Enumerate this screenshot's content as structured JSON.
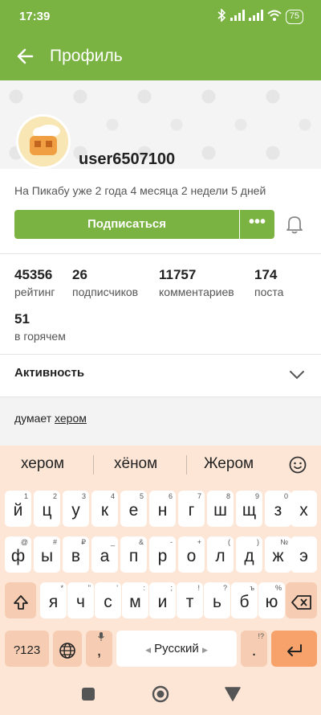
{
  "status": {
    "time": "17:39",
    "battery": "75"
  },
  "appbar": {
    "title": "Профиль"
  },
  "profile": {
    "username": "user6507100",
    "since": "На Пикабу уже 2 года 4 месяца 2 недели 5 дней",
    "subscribe_label": "Подписаться",
    "more_label": "•••"
  },
  "stats": [
    {
      "num": "45356",
      "label": "рейтинг"
    },
    {
      "num": "26",
      "label": "подписчиков"
    },
    {
      "num": "11757",
      "label": "комментариев"
    },
    {
      "num": "174",
      "label": "поста"
    },
    {
      "num": "51",
      "label": "в горячем"
    }
  ],
  "activity": {
    "label": "Активность"
  },
  "thinks": {
    "prefix": "думает",
    "link": "хером"
  },
  "keyboard": {
    "suggestions": [
      "хером",
      "хёном",
      "Жером"
    ],
    "row1": [
      {
        "k": "й",
        "s": "1"
      },
      {
        "k": "ц",
        "s": "2"
      },
      {
        "k": "у",
        "s": "3"
      },
      {
        "k": "к",
        "s": "4"
      },
      {
        "k": "е",
        "s": "5"
      },
      {
        "k": "н",
        "s": "6"
      },
      {
        "k": "г",
        "s": "7"
      },
      {
        "k": "ш",
        "s": "8"
      },
      {
        "k": "щ",
        "s": "9"
      },
      {
        "k": "з",
        "s": "0"
      },
      {
        "k": "х",
        "s": ""
      }
    ],
    "row2": [
      {
        "k": "ф",
        "s": "@"
      },
      {
        "k": "ы",
        "s": "#"
      },
      {
        "k": "в",
        "s": "₽"
      },
      {
        "k": "а",
        "s": "_"
      },
      {
        "k": "п",
        "s": "&"
      },
      {
        "k": "р",
        "s": "-"
      },
      {
        "k": "о",
        "s": "+"
      },
      {
        "k": "л",
        "s": "("
      },
      {
        "k": "д",
        "s": ")"
      },
      {
        "k": "ж",
        "s": "№"
      },
      {
        "k": "э",
        "s": ""
      }
    ],
    "row3": [
      {
        "k": "я",
        "s": "*"
      },
      {
        "k": "ч",
        "s": "\""
      },
      {
        "k": "с",
        "s": "'"
      },
      {
        "k": "м",
        "s": ":"
      },
      {
        "k": "и",
        "s": ";"
      },
      {
        "k": "т",
        "s": "!"
      },
      {
        "k": "ь",
        "s": "?"
      },
      {
        "k": "б",
        "s": "ъ"
      },
      {
        "k": "ю",
        "s": "%"
      }
    ],
    "sym_label": "?123",
    "comma": ",",
    "space_label": "Русский",
    "period": ".",
    "period_sub": "!?"
  }
}
